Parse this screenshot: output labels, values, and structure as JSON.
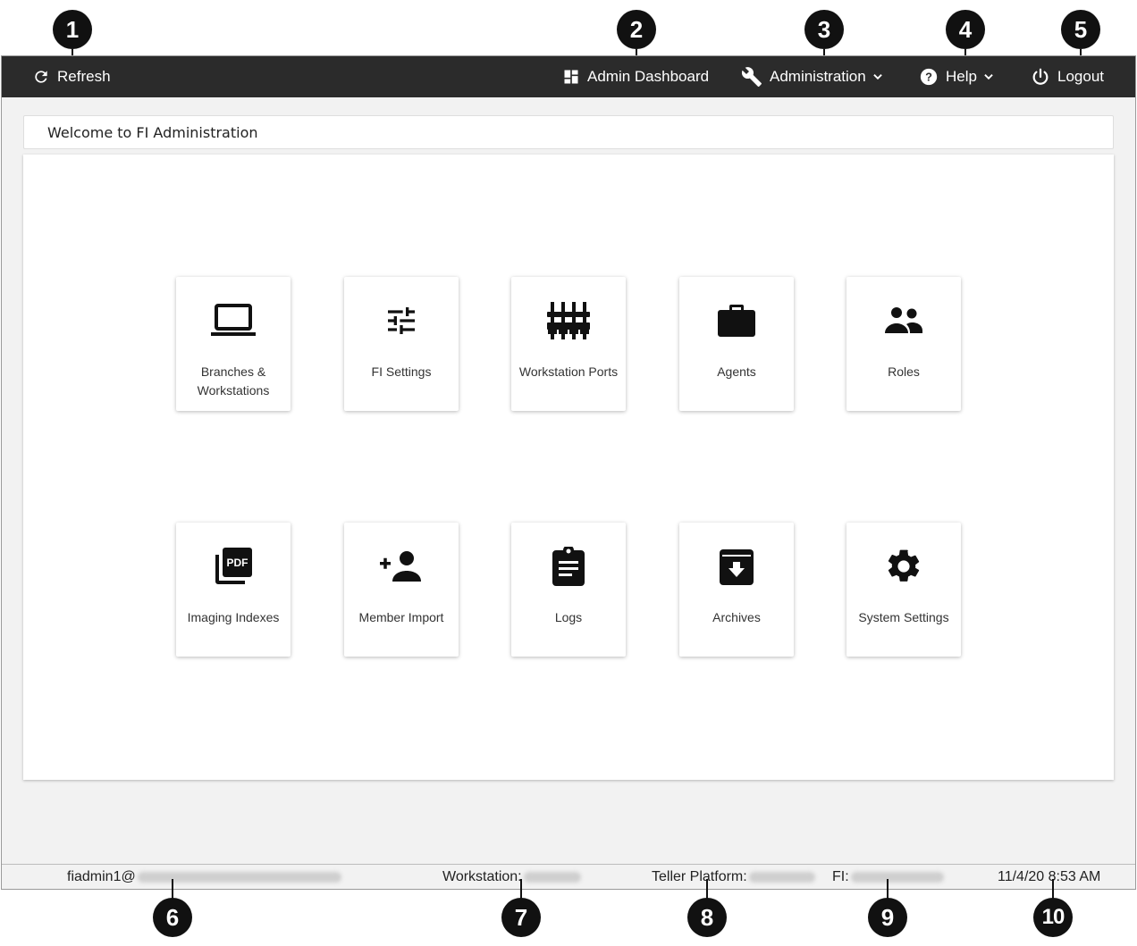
{
  "callouts": [
    "1",
    "2",
    "3",
    "4",
    "5",
    "6",
    "7",
    "8",
    "9",
    "10"
  ],
  "header": {
    "refresh_label": "Refresh",
    "admin_dashboard_label": "Admin Dashboard",
    "administration_label": "Administration",
    "help_label": "Help",
    "logout_label": "Logout"
  },
  "welcome": "Welcome to FI Administration",
  "tiles": [
    {
      "label": "Branches & Workstations",
      "icon": "laptop-icon"
    },
    {
      "label": "FI Settings",
      "icon": "tune-icon"
    },
    {
      "label": "Workstation Ports",
      "icon": "ports-icon"
    },
    {
      "label": "Agents",
      "icon": "briefcase-icon"
    },
    {
      "label": "Roles",
      "icon": "people-icon"
    },
    {
      "label": "Imaging Indexes",
      "icon": "pdf-icon"
    },
    {
      "label": "Member Import",
      "icon": "person-add-icon"
    },
    {
      "label": "Logs",
      "icon": "clipboard-icon"
    },
    {
      "label": "Archives",
      "icon": "archive-icon"
    },
    {
      "label": "System Settings",
      "icon": "gear-icon"
    }
  ],
  "status": {
    "user_prefix": "fiadmin1@",
    "workstation_label": "Workstation:",
    "teller_platform_label": "Teller Platform:",
    "fi_label": "FI:",
    "datetime": "11/4/20 8:53 AM"
  },
  "colors": {
    "topbar": "#2b2b2b",
    "background": "#f2f2f2",
    "callout": "#111111"
  }
}
